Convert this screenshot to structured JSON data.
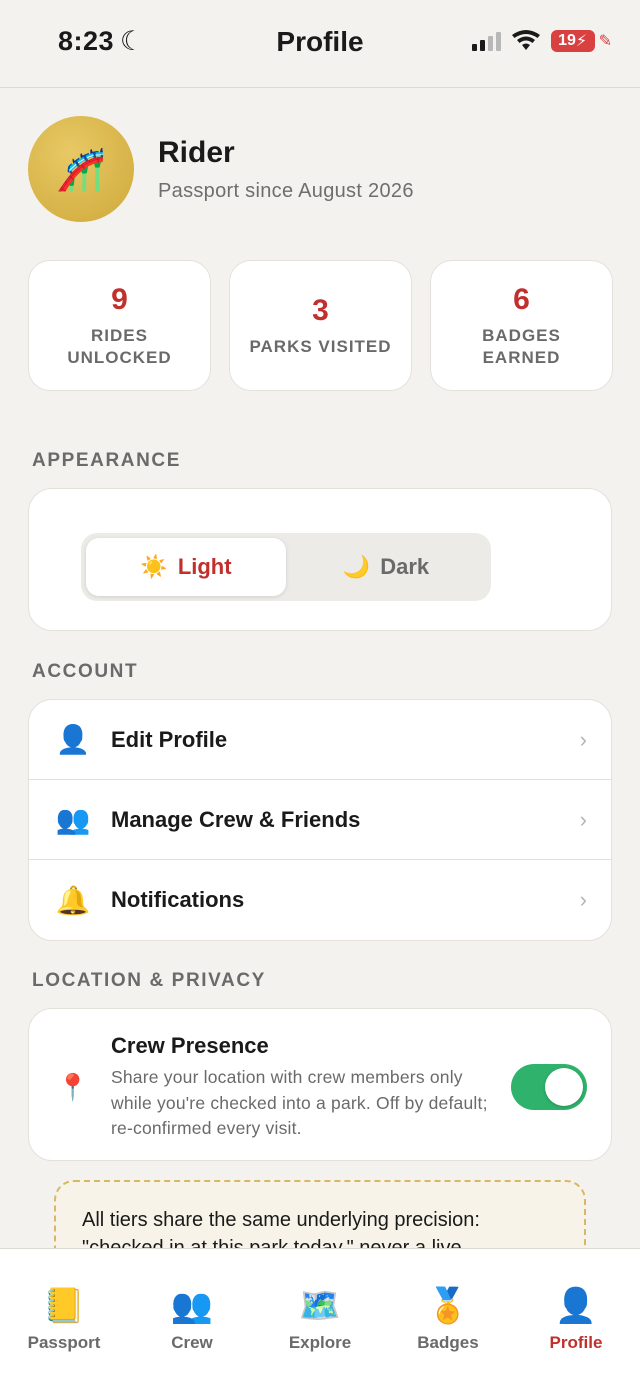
{
  "status_bar": {
    "time": "8:23",
    "battery": "19"
  },
  "header": {
    "title": "Profile"
  },
  "profile": {
    "avatar_icon": "roller-coaster-icon",
    "name": "Rider",
    "subtitle": "Passport since August 2026"
  },
  "stats": [
    {
      "value": "9",
      "label": "RIDES UNLOCKED"
    },
    {
      "value": "3",
      "label": "PARKS VISITED"
    },
    {
      "value": "6",
      "label": "BADGES EARNED"
    }
  ],
  "appearance": {
    "section_label": "APPEARANCE",
    "options": [
      {
        "icon": "☀️",
        "label": "Light",
        "selected": true
      },
      {
        "icon": "🌙",
        "label": "Dark",
        "selected": false
      }
    ]
  },
  "account": {
    "section_label": "ACCOUNT",
    "items": [
      {
        "icon": "👤",
        "label": "Edit Profile"
      },
      {
        "icon": "👥",
        "label": "Manage Crew & Friends"
      },
      {
        "icon": "🔔",
        "label": "Notifications"
      }
    ]
  },
  "privacy": {
    "section_label": "LOCATION & PRIVACY",
    "crew_presence": {
      "icon": "📍",
      "title": "Crew Presence",
      "description": "Share your location with crew members only while you're checked into a park. Off by default; re-confirmed every visit.",
      "enabled": true
    }
  },
  "note": {
    "text": "All tiers share the same underlying precision: \"checked in at this park today,\" never a live"
  },
  "tabbar": {
    "items": [
      {
        "icon": "📒",
        "label": "Passport",
        "active": false
      },
      {
        "icon": "👥",
        "label": "Crew",
        "active": false
      },
      {
        "icon": "🗺️",
        "label": "Explore",
        "active": false
      },
      {
        "icon": "🏅",
        "label": "Badges",
        "active": false
      },
      {
        "icon": "👤",
        "label": "Profile",
        "active": true
      }
    ]
  },
  "colors": {
    "accent": "#c0302c",
    "toggle_on": "#2fb26b",
    "background": "#f3f2ef"
  }
}
